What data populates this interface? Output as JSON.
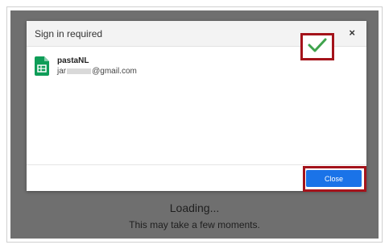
{
  "dialog": {
    "title": "Sign in required",
    "close_symbol": "×",
    "account": {
      "icon": "google-sheets-icon",
      "name": "pastaNL",
      "email_prefix": "jar",
      "email_suffix": "@gmail.com"
    },
    "confirm_icon": "checkmark-icon",
    "close_label": "Close"
  },
  "background": {
    "loading_title": "Loading...",
    "loading_subtitle": "This may take a few moments."
  },
  "colors": {
    "overlay": "#6f6f6f",
    "primary_button": "#1a73e8",
    "highlight": "#a4131b",
    "check": "#3fa34d",
    "sheets_green": "#0f9d58"
  }
}
